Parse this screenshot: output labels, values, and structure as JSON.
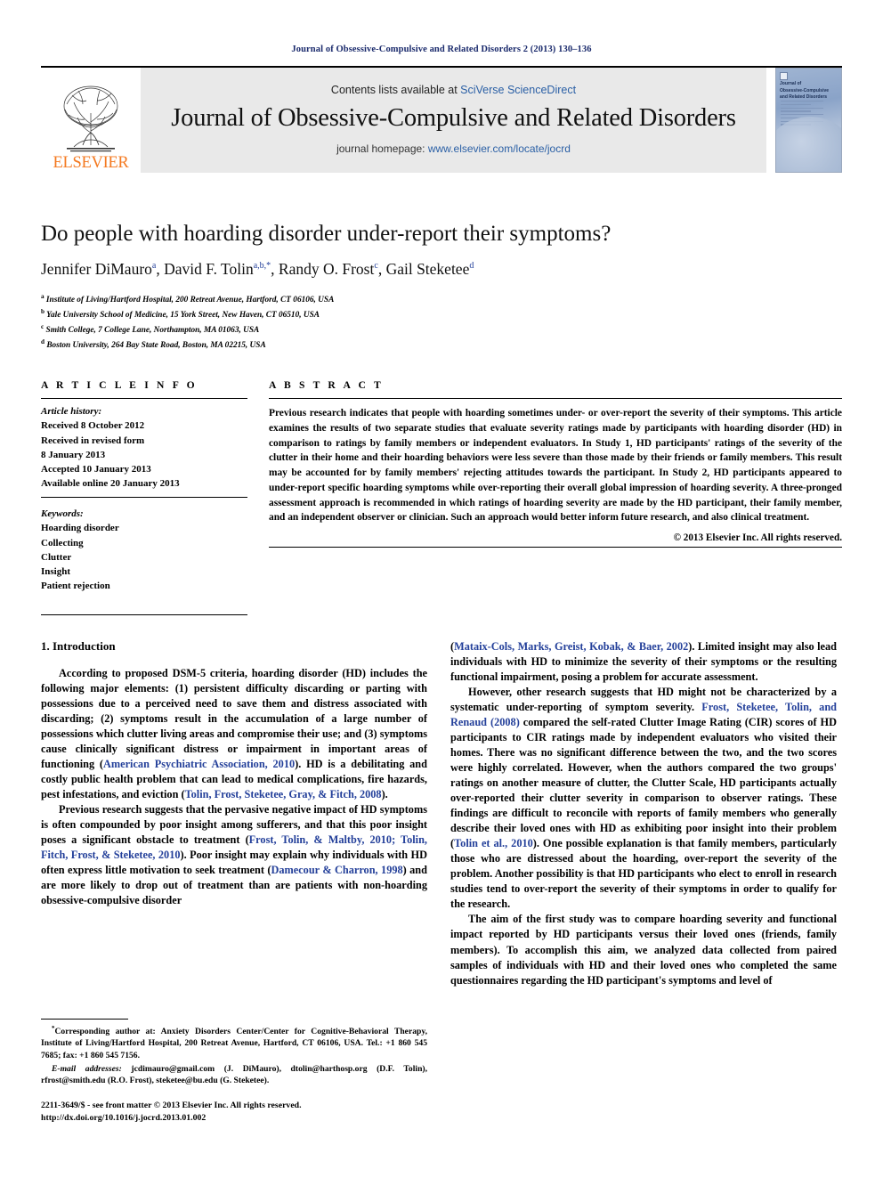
{
  "running_head": "Journal of Obsessive-Compulsive and Related Disorders 2 (2013) 130–136",
  "masthead": {
    "publisher_name": "ELSEVIER",
    "contents_prefix": "Contents lists available at ",
    "contents_link": "SciVerse ScienceDirect",
    "journal_title": "Journal of Obsessive-Compulsive and Related Disorders",
    "homepage_prefix": "journal homepage: ",
    "homepage_link": "www.elsevier.com/locate/jocrd",
    "cover": {
      "line1": "Journal of",
      "line2": "Obsessive-Compulsive",
      "line3": "and Related Disorders"
    }
  },
  "article": {
    "title": "Do people with hoarding disorder under-report their symptoms?",
    "authors": [
      {
        "name": "Jennifer DiMauro",
        "sup": "a"
      },
      {
        "name": "David F. Tolin",
        "sup": "a,b,*"
      },
      {
        "name": "Randy O. Frost",
        "sup": "c"
      },
      {
        "name": "Gail Steketee",
        "sup": "d"
      }
    ],
    "affiliations": [
      {
        "sup": "a",
        "text": "Institute of Living/Hartford Hospital, 200 Retreat Avenue, Hartford, CT 06106, USA"
      },
      {
        "sup": "b",
        "text": "Yale University School of Medicine, 15 York Street, New Haven, CT 06510, USA"
      },
      {
        "sup": "c",
        "text": "Smith College, 7 College Lane, Northampton, MA 01063, USA"
      },
      {
        "sup": "d",
        "text": "Boston University, 264 Bay State Road, Boston, MA 02215, USA"
      }
    ]
  },
  "article_info": {
    "heading": "A R T I C L E   I N F O",
    "history_label": "Article history:",
    "history": [
      "Received 8 October 2012",
      "Received in revised form",
      "8 January 2013",
      "Accepted 10 January 2013",
      "Available online 20 January 2013"
    ],
    "keywords_label": "Keywords:",
    "keywords": [
      "Hoarding disorder",
      "Collecting",
      "Clutter",
      "Insight",
      "Patient rejection"
    ]
  },
  "abstract": {
    "heading": "A B S T R A C T",
    "text": "Previous research indicates that people with hoarding sometimes under- or over-report the severity of their symptoms. This article examines the results of two separate studies that evaluate severity ratings made by participants with hoarding disorder (HD) in comparison to ratings by family members or independent evaluators. In Study 1, HD participants' ratings of the severity of the clutter in their home and their hoarding behaviors were less severe than those made by their friends or family members. This result may be accounted for by family members' rejecting attitudes towards the participant. In Study 2, HD participants appeared to under-report specific hoarding symptoms while over-reporting their overall global impression of hoarding severity. A three-pronged assessment approach is recommended in which ratings of hoarding severity are made by the HD participant, their family member, and an independent observer or clinician. Such an approach would better inform future research, and also clinical treatment.",
    "copyright": "© 2013 Elsevier Inc. All rights reserved."
  },
  "introduction": {
    "heading": "1. Introduction",
    "left_paragraphs": [
      "According to proposed DSM-5 criteria, hoarding disorder (HD) includes the following major elements: (1) persistent difficulty discarding or parting with possessions due to a perceived need to save them and distress associated with discarding; (2) symptoms result in the accumulation of a large number of possessions which clutter living areas and compromise their use; and (3) symptoms cause clinically significant distress or impairment in important areas of functioning (American Psychiatric Association, 2010). HD is a debilitating and costly public health problem that can lead to medical complications, fire hazards, pest infestations, and eviction (Tolin, Frost, Steketee, Gray, & Fitch, 2008).",
      "Previous research suggests that the pervasive negative impact of HD symptoms is often compounded by poor insight among sufferers, and that this poor insight poses a significant obstacle to treatment (Frost, Tolin, & Maltby, 2010; Tolin, Fitch, Frost, & Steketee, 2010). Poor insight may explain why individuals with HD often express little motivation to seek treatment (Damecour & Charron, 1998) and are more likely to drop out of treatment than are patients with non-hoarding obsessive-compulsive disorder"
    ],
    "right_paragraphs": [
      "(Mataix-Cols, Marks, Greist, Kobak, & Baer, 2002). Limited insight may also lead individuals with HD to minimize the severity of their symptoms or the resulting functional impairment, posing a problem for accurate assessment.",
      "However, other research suggests that HD might not be characterized by a systematic under-reporting of symptom severity. Frost, Steketee, Tolin, and Renaud (2008) compared the self-rated Clutter Image Rating (CIR) scores of HD participants to CIR ratings made by independent evaluators who visited their homes. There was no significant difference between the two, and the two scores were highly correlated. However, when the authors compared the two groups' ratings on another measure of clutter, the Clutter Scale, HD participants actually over-reported their clutter severity in comparison to observer ratings. These findings are difficult to reconcile with reports of family members who generally describe their loved ones with HD as exhibiting poor insight into their problem (Tolin et al., 2010). One possible explanation is that family members, particularly those who are distressed about the hoarding, over-report the severity of the problem. Another possibility is that HD participants who elect to enroll in research studies tend to over-report the severity of their symptoms in order to qualify for the research.",
      "The aim of the first study was to compare hoarding severity and functional impact reported by HD participants versus their loved ones (friends, family members). To accomplish this aim, we analyzed data collected from paired samples of individuals with HD and their loved ones who completed the same questionnaires regarding the HD participant's symptoms and level of"
    ]
  },
  "footnote": {
    "marker": "*",
    "corresponding": "Corresponding author at: Anxiety Disorders Center/Center for Cognitive-Behavioral Therapy, Institute of Living/Hartford Hospital, 200 Retreat Avenue, Hartford, CT 06106, USA. Tel.: +1 860 545 7685; fax: +1 860 545 7156.",
    "email_label": "E-mail addresses:",
    "emails": "jcdimauro@gmail.com (J. DiMauro), dtolin@harthosp.org (D.F. Tolin), rfrost@smith.edu (R.O. Frost), steketee@bu.edu (G. Steketee).",
    "issn_line": "2211-3649/$ - see front matter © 2013 Elsevier Inc. All rights reserved.",
    "doi_line": "http://dx.doi.org/10.1016/j.jocrd.2013.01.002"
  },
  "colors": {
    "link_blue": "#2a5fa5",
    "citation_blue": "#24409a",
    "elsevier_orange": "#F47920",
    "running_head_navy": "#1a2a6c"
  }
}
